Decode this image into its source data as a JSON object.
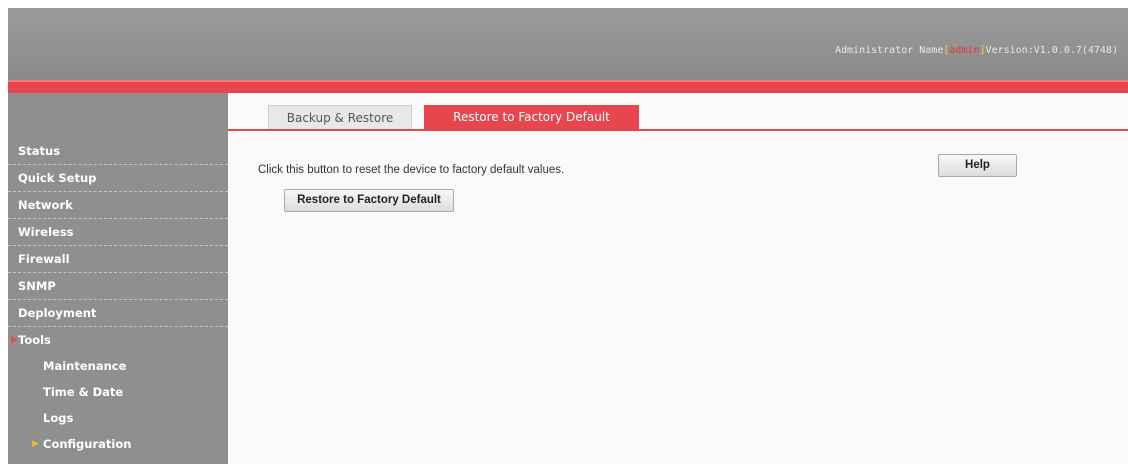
{
  "header": {
    "admin_label": "Administrator Name",
    "bracket_open": "[",
    "admin_name": "admin",
    "bracket_close": "]",
    "version": "Version:V1.0.0.7(4748)"
  },
  "sidebar": {
    "items": [
      {
        "label": "Status"
      },
      {
        "label": "Quick Setup"
      },
      {
        "label": "Network"
      },
      {
        "label": "Wireless"
      },
      {
        "label": "Firewall"
      },
      {
        "label": "SNMP"
      },
      {
        "label": "Deployment"
      },
      {
        "label": "Tools"
      }
    ],
    "subitems": [
      {
        "label": "Maintenance"
      },
      {
        "label": "Time & Date"
      },
      {
        "label": "Logs"
      },
      {
        "label": "Configuration"
      }
    ]
  },
  "tabs": [
    {
      "label": "Backup & Restore"
    },
    {
      "label": "Restore to Factory Default"
    }
  ],
  "main": {
    "description": "Click this button to reset the device to factory default values.",
    "restore_button": "Restore to Factory Default",
    "help_button": "Help"
  },
  "colors": {
    "accent": "#e8464e",
    "sidebar": "#8f8f8f",
    "header": "#9b9b9b"
  }
}
